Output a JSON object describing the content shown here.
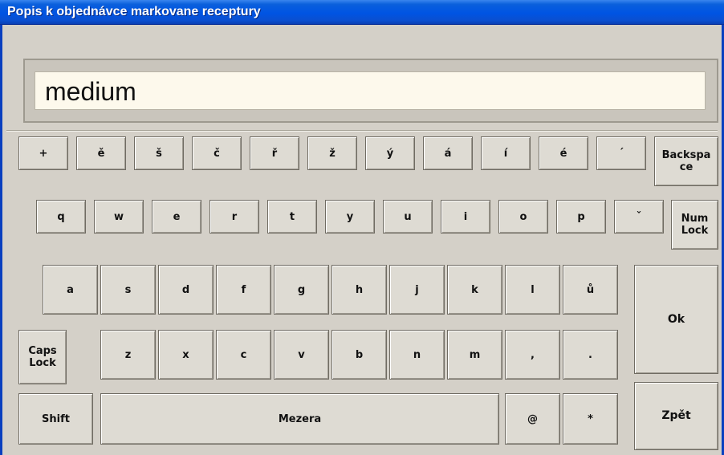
{
  "window": {
    "title": "Popis k objednávce markovane receptury"
  },
  "input": {
    "value": "medium"
  },
  "keyboard": {
    "row1": [
      "+",
      "ě",
      "š",
      "č",
      "ř",
      "ž",
      "ý",
      "á",
      "í",
      "é",
      "´",
      "Backspa ce"
    ],
    "row2": [
      "q",
      "w",
      "e",
      "r",
      "t",
      "y",
      "u",
      "i",
      "o",
      "p",
      "ˇ",
      "Num Lock"
    ],
    "row3": [
      "a",
      "s",
      "d",
      "f",
      "g",
      "h",
      "j",
      "k",
      "l",
      "ů"
    ],
    "row4": [
      "Caps Lock",
      "z",
      "x",
      "c",
      "v",
      "b",
      "n",
      "m",
      ",",
      "."
    ],
    "row5": [
      "Shift",
      "Mezera",
      "@",
      "*"
    ],
    "ok": "Ok",
    "back": "Zpět"
  }
}
